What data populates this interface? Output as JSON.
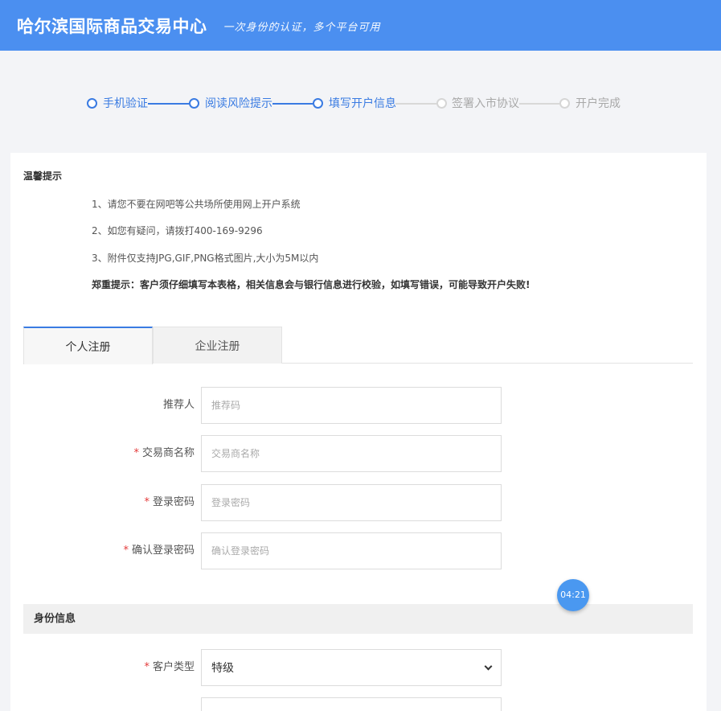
{
  "header": {
    "title": "哈尔滨国际商品交易中心",
    "slogan": "一次身份的认证，多个平台可用"
  },
  "steps": [
    {
      "label": "手机验证",
      "state": "done"
    },
    {
      "label": "阅读风险提示",
      "state": "done"
    },
    {
      "label": "填写开户信息",
      "state": "current"
    },
    {
      "label": "签署入市协议",
      "state": "pending"
    },
    {
      "label": "开户完成",
      "state": "pending"
    }
  ],
  "tips": {
    "title": "温馨提示",
    "items": [
      "1、请您不要在网吧等公共场所使用网上开户系统",
      "2、如您有疑问，请拨打400-169-9296",
      "3、附件仅支持JPG,GIF,PNG格式图片,大小为5M以内"
    ],
    "important": "郑重提示：客户须仔细填写本表格，相关信息会与银行信息进行校验，如填写错误，可能导致开户失败!"
  },
  "tabs": [
    {
      "label": "个人注册",
      "active": true
    },
    {
      "label": "企业注册",
      "active": false
    }
  ],
  "form": {
    "referrer": {
      "label": "推荐人",
      "placeholder": "推荐码",
      "value": ""
    },
    "trader_name": {
      "label": "交易商名称",
      "placeholder": "交易商名称",
      "value": "",
      "required": "*"
    },
    "password": {
      "label": "登录密码",
      "placeholder": "登录密码",
      "value": "",
      "required": "*"
    },
    "confirm_password": {
      "label": "确认登录密码",
      "placeholder": "确认登录密码",
      "value": "",
      "required": "*"
    }
  },
  "identity": {
    "title": "身份信息",
    "customer_type": {
      "label": "客户类型",
      "value": "特级",
      "required": "*"
    }
  },
  "timer": "04:21",
  "colors": {
    "header_bg": "#4b8ff0",
    "accent": "#3a7be2",
    "required": "#e43a3a",
    "timer_bg": "#4a98f0"
  }
}
